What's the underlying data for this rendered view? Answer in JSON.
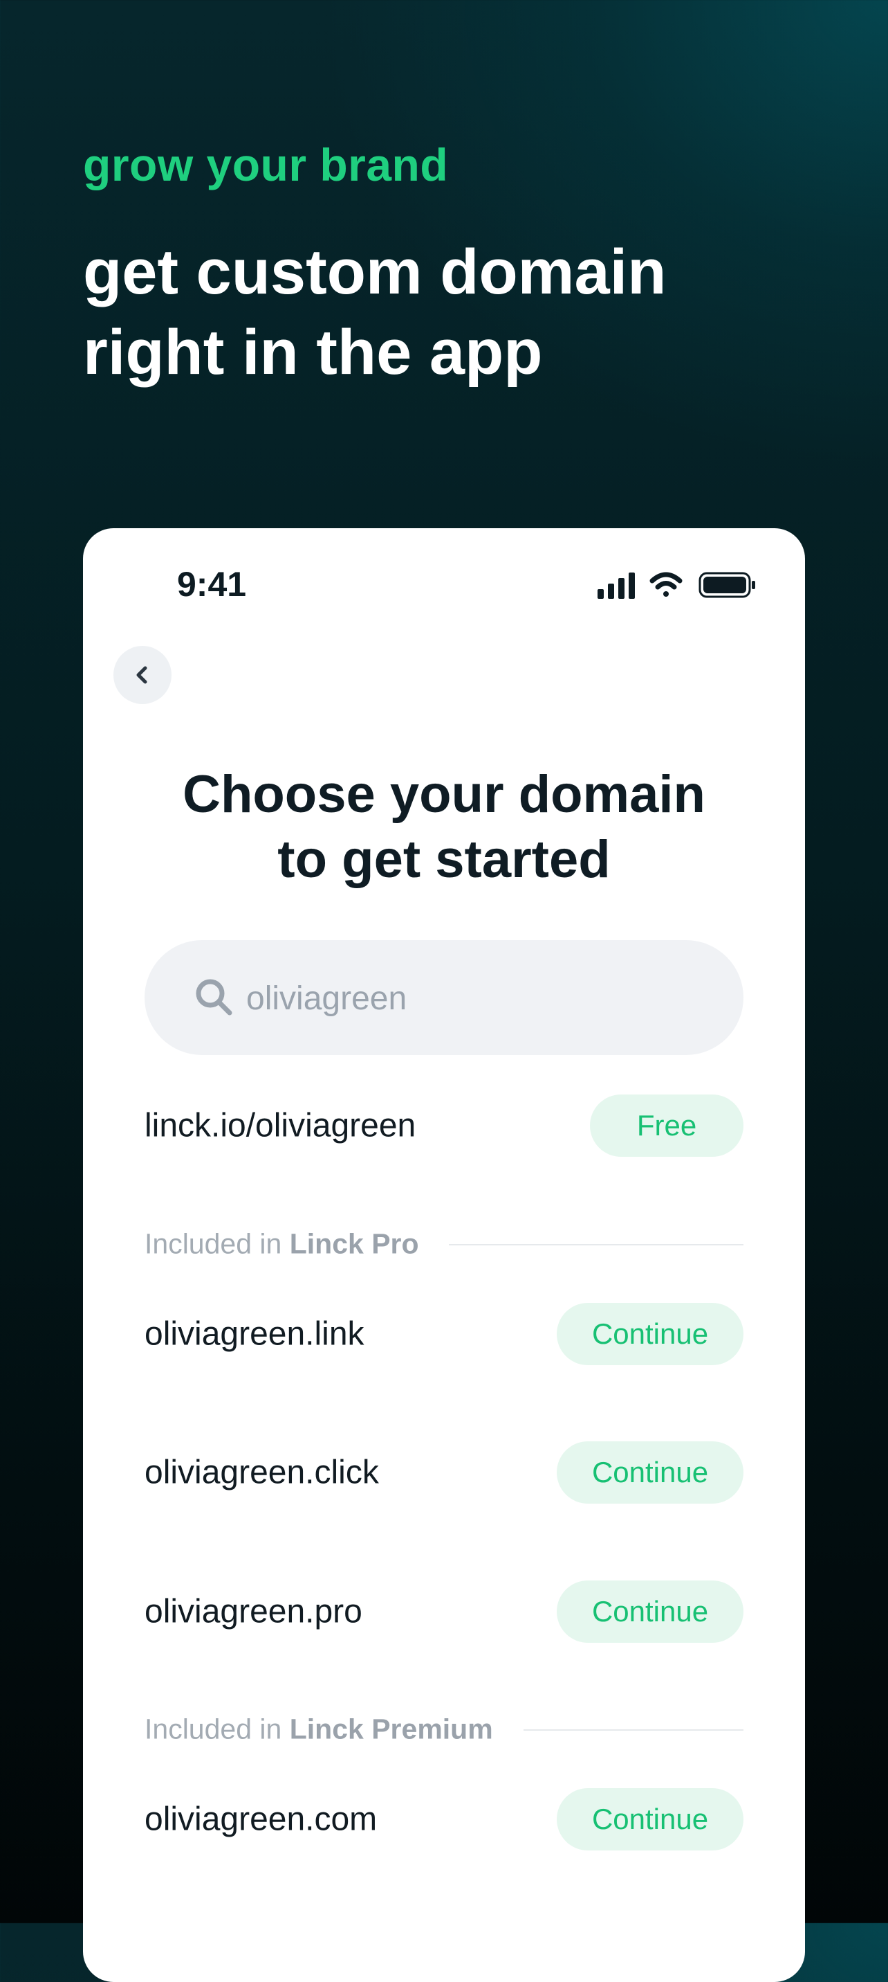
{
  "promo": {
    "eyebrow": "grow your brand",
    "headline_line1": "get custom domain",
    "headline_line2": "right in the app"
  },
  "status_bar": {
    "time": "9:41",
    "icons": [
      "signal-icon",
      "wifi-icon",
      "battery-icon"
    ]
  },
  "screen": {
    "back_icon": "chevron-left-icon",
    "title_line1": "Choose your domain",
    "title_line2": "to get started",
    "search": {
      "value": "",
      "placeholder": "oliviagreen",
      "icon": "search-icon"
    },
    "free_domain": {
      "label": "linck.io/oliviagreen",
      "action": "Free"
    },
    "sections": [
      {
        "prefix": "Included in",
        "plan": "Linck Pro",
        "domains": [
          {
            "label": "oliviagreen.link",
            "action": "Continue"
          },
          {
            "label": "oliviagreen.click",
            "action": "Continue"
          },
          {
            "label": "oliviagreen.pro",
            "action": "Continue"
          }
        ]
      },
      {
        "prefix": "Included in",
        "plan": "Linck Premium",
        "domains": [
          {
            "label": "oliviagreen.com",
            "action": "Continue"
          }
        ]
      }
    ]
  },
  "colors": {
    "accent": "#1fcf7f",
    "pill_bg": "#e5f7ee",
    "pill_text": "#17c073",
    "background_dark": "#041c20"
  }
}
